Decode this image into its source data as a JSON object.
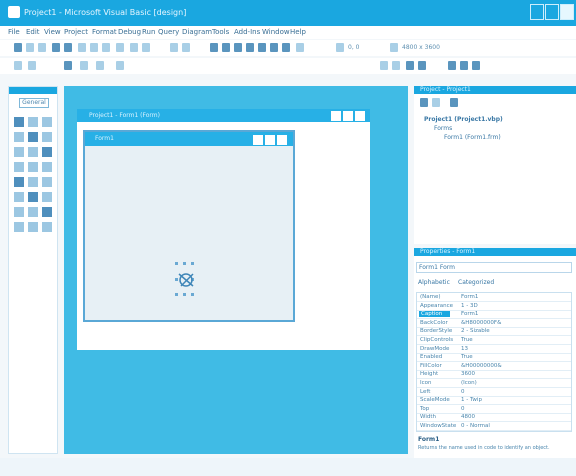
{
  "window": {
    "title": "Project1 - Microsoft Visual Basic [design]"
  },
  "menu": [
    "File",
    "Edit",
    "View",
    "Project",
    "Format",
    "Debug",
    "Run",
    "Query",
    "Diagram",
    "Tools",
    "Add-Ins",
    "Window",
    "Help"
  ],
  "toolbar1": {
    "coord1": "0, 0",
    "coord2": "4800 x 3600"
  },
  "toolbox": {
    "tab_label": "General"
  },
  "designer": {
    "outer_title": "Project1 - Form1 (Form)",
    "inner_title": "Form1"
  },
  "project_panel": {
    "title": "Project - Project1",
    "items": [
      "Project1 (Project1.vbp)",
      "Forms",
      "Form1 (Form1.frm)"
    ]
  },
  "properties_panel": {
    "title": "Properties - Form1",
    "object": "Form1 Form",
    "tabs": [
      "Alphabetic",
      "Categorized"
    ],
    "rows": [
      {
        "k": "(Name)",
        "v": "Form1"
      },
      {
        "k": "Appearance",
        "v": "1 - 3D"
      },
      {
        "k": "Caption",
        "v": "Form1",
        "sel": true
      },
      {
        "k": "BackColor",
        "v": "&H8000000F&"
      },
      {
        "k": "BorderStyle",
        "v": "2 - Sizable"
      },
      {
        "k": "ClipControls",
        "v": "True"
      },
      {
        "k": "DrawMode",
        "v": "13"
      },
      {
        "k": "Enabled",
        "v": "True"
      },
      {
        "k": "FillColor",
        "v": "&H00000000&"
      },
      {
        "k": "Height",
        "v": "3600"
      },
      {
        "k": "Icon",
        "v": "(Icon)"
      },
      {
        "k": "Left",
        "v": "0"
      },
      {
        "k": "ScaleMode",
        "v": "1 - Twip"
      },
      {
        "k": "Top",
        "v": "0"
      },
      {
        "k": "Width",
        "v": "4800"
      },
      {
        "k": "WindowState",
        "v": "0 - Normal"
      }
    ],
    "description_title": "Form1",
    "description": "Returns the name used in code to identify an object."
  },
  "colors": {
    "accent": "#1aa7e0",
    "workspace": "#40bbe5"
  }
}
